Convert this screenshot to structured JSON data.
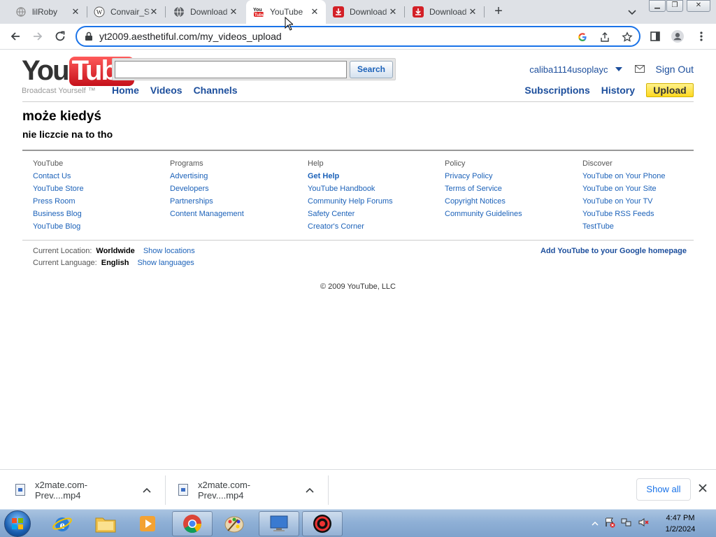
{
  "browser": {
    "tabs": [
      {
        "title": "lilRoby",
        "icon": "globe-icon",
        "active": false
      },
      {
        "title": "Convair_S",
        "icon": "wikipedia-icon",
        "active": false
      },
      {
        "title": "Download",
        "icon": "globe-icon",
        "active": false
      },
      {
        "title": "YouTube",
        "icon": "youtube-icon",
        "active": true
      },
      {
        "title": "Download",
        "icon": "download-icon",
        "active": false
      },
      {
        "title": "Download",
        "icon": "download-icon",
        "active": false
      }
    ],
    "url": "yt2009.aesthetiful.com/my_videos_upload"
  },
  "page": {
    "logo": {
      "you": "You",
      "tube": "Tube",
      "tagline": "Broadcast Yourself ™"
    },
    "search": {
      "value": "",
      "button": "Search"
    },
    "nav": [
      "Home",
      "Videos",
      "Channels"
    ],
    "user": {
      "name": "caliba1114usoplayc",
      "signout": "Sign Out"
    },
    "right_nav": {
      "subscriptions": "Subscriptions",
      "history": "History",
      "upload": "Upload"
    },
    "heading": "może kiedyś",
    "subheading": "nie liczcie na to tho",
    "footer": {
      "columns": [
        {
          "head": "YouTube",
          "links": [
            "Contact Us",
            "YouTube Store",
            "Press Room",
            "Business Blog",
            "YouTube Blog"
          ]
        },
        {
          "head": "Programs",
          "links": [
            "Advertising",
            "Developers",
            "Partnerships",
            "Content Management"
          ]
        },
        {
          "head": "Help",
          "links": [
            "Get Help",
            "YouTube Handbook",
            "Community Help Forums",
            "Safety Center",
            "Creator's Corner"
          ]
        },
        {
          "head": "Policy",
          "links": [
            "Privacy Policy",
            "Terms of Service",
            "Copyright Notices",
            "Community Guidelines"
          ]
        },
        {
          "head": "Discover",
          "links": [
            "YouTube on Your Phone",
            "YouTube on Your Site",
            "YouTube on Your TV",
            "YouTube RSS Feeds",
            "TestTube"
          ]
        }
      ],
      "location_label": "Current Location:",
      "location_value": "Worldwide",
      "location_link": "Show locations",
      "language_label": "Current Language:",
      "language_value": "English",
      "language_link": "Show languages",
      "add_homepage": "Add YouTube to your Google homepage",
      "copyright": "© 2009 YouTube, LLC"
    }
  },
  "downloads": {
    "items": [
      "x2mate.com-Prev....mp4",
      "x2mate.com-Prev....mp4"
    ],
    "show_all": "Show all"
  },
  "taskbar": {
    "time": "4:47 PM",
    "date": "1/2/2024"
  },
  "colors": {
    "link": "#1c62b9",
    "nav": "#1c4e9c",
    "upload_button": "#ffd820",
    "omnibox_focus": "#1a73e8"
  }
}
